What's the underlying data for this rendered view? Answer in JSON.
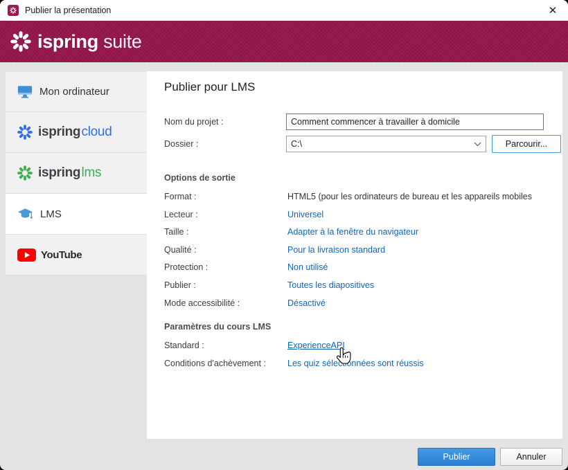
{
  "window": {
    "title": "Publier la présentation"
  },
  "icons": {
    "close": "✕"
  },
  "header": {
    "brand_primary": "ispring",
    "brand_secondary": "suite",
    "banner_color": "#9b1b51"
  },
  "sidebar": {
    "items": [
      {
        "label": "Mon ordinateur",
        "icon": "monitor-icon",
        "selected": false
      },
      {
        "brand": "ispring",
        "suffix": "cloud",
        "icon": "ispring-spinner-icon",
        "suffix_color": "#2d6ef2",
        "selected": false
      },
      {
        "brand": "ispring",
        "suffix": "lms",
        "icon": "ispring-spinner-icon",
        "suffix_color": "#3cae4e",
        "selected": false
      },
      {
        "label": "LMS",
        "icon": "graduation-cap-icon",
        "selected": true
      },
      {
        "label": "YouTube",
        "icon": "youtube-icon",
        "selected": false
      }
    ]
  },
  "main": {
    "title": "Publier pour LMS",
    "form": {
      "project_name_label": "Nom du projet :",
      "project_name_value": "Comment commencer à travailler à domicile",
      "folder_label": "Dossier :",
      "folder_value": "C:\\",
      "browse_button": "Parcourir..."
    },
    "output_options": {
      "heading": "Options de sortie",
      "rows": [
        {
          "label": "Format :",
          "value": "HTML5 (pour les ordinateurs de bureau et les appareils mobiles",
          "link": false
        },
        {
          "label": "Lecteur :",
          "value": "Universel",
          "link": true
        },
        {
          "label": "Taille :",
          "value": "Adapter à la fenêtre du navigateur",
          "link": true
        },
        {
          "label": "Qualité :",
          "value": "Pour la livraison standard",
          "link": true
        },
        {
          "label": "Protection :",
          "value": "Non utilisé",
          "link": true
        },
        {
          "label": "Publier :",
          "value": "Toutes les diapositives",
          "link": true
        },
        {
          "label": "Mode accessibilité :",
          "value": "Désactivé",
          "link": true
        }
      ]
    },
    "lms_settings": {
      "heading": "Paramètres du cours LMS",
      "rows": [
        {
          "label": "Standard :",
          "value": "ExperienceAPI",
          "link": true,
          "underlined": true
        },
        {
          "label": "Conditions d'achèvement :",
          "value": "Les quiz sélectionnées sont réussis",
          "link": true
        }
      ]
    }
  },
  "footer": {
    "publish_button": "Publier",
    "cancel_button": "Annuler"
  },
  "colors": {
    "banner": "#9b1b51",
    "link": "#1266b6",
    "publish_button": "#2e86d4",
    "youtube_red": "#ff0000"
  }
}
